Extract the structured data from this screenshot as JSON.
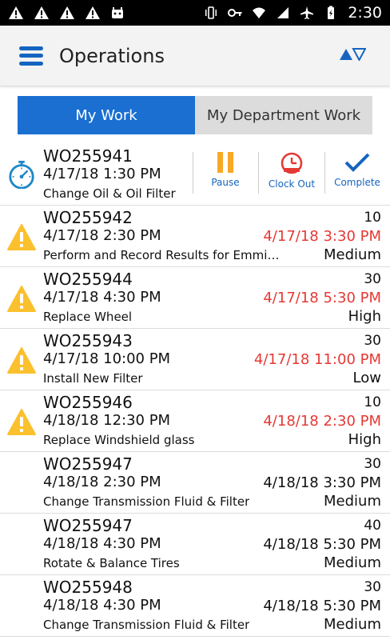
{
  "status_bar": {
    "time": "2:30",
    "icons": [
      "warning-icon",
      "warning-icon",
      "warning-icon",
      "warning-icon",
      "android-icon",
      "vibrate-icon",
      "key-icon",
      "wifi-icon",
      "signal-icon",
      "airplane-icon",
      "battery-icon"
    ]
  },
  "header": {
    "title": "Operations",
    "icons": [
      "menu-icon",
      "sort-icon"
    ]
  },
  "tabs": {
    "my_work": "My Work",
    "dept_work": "My Department Work"
  },
  "colors": {
    "accent": "#1a6fd1",
    "overdue": "#e53935",
    "warning": "#fbc02d",
    "pause": "#f9a825",
    "clockout": "#e53935"
  },
  "active": {
    "wo": "WO255941",
    "datetime": "4/17/18 1:30 PM",
    "desc": "Change Oil & Oil Filter",
    "icon": "stopwatch-icon",
    "actions": {
      "pause": "Pause",
      "clock_out": "Clock Out",
      "complete": "Complete"
    }
  },
  "orders": [
    {
      "wo": "WO255942",
      "datetime": "4/17/18 2:30 PM",
      "desc": "Perform and Record Results for Emmisi...",
      "num": "10",
      "due": "4/17/18 3:30 PM",
      "priority": "Medium",
      "warning": true
    },
    {
      "wo": "WO255944",
      "datetime": "4/17/18 4:30 PM",
      "desc": "Replace Wheel",
      "num": "30",
      "due": "4/17/18 5:30 PM",
      "priority": "High",
      "warning": true
    },
    {
      "wo": "WO255943",
      "datetime": "4/17/18 10:00 PM",
      "desc": "Install New Filter",
      "num": "30",
      "due": "4/17/18 11:00 PM",
      "priority": "Low",
      "warning": true
    },
    {
      "wo": "WO255946",
      "datetime": "4/18/18 12:30 PM",
      "desc": "Replace Windshield glass",
      "num": "10",
      "due": "4/18/18 2:30 PM",
      "priority": "High",
      "warning": true
    },
    {
      "wo": "WO255947",
      "datetime": "4/18/18 2:30 PM",
      "desc": "Change Transmission Fluid & Filter",
      "num": "30",
      "due": "4/18/18 3:30 PM",
      "priority": "Medium",
      "warning": false
    },
    {
      "wo": "WO255947",
      "datetime": "4/18/18 4:30 PM",
      "desc": "Rotate & Balance Tires",
      "num": "40",
      "due": "4/18/18 5:30 PM",
      "priority": "Medium",
      "warning": false
    },
    {
      "wo": "WO255948",
      "datetime": "4/18/18 4:30 PM",
      "desc": "Change Transmission Fluid & Filter",
      "num": "30",
      "due": "4/18/18 5:30 PM",
      "priority": "Medium",
      "warning": false
    }
  ]
}
